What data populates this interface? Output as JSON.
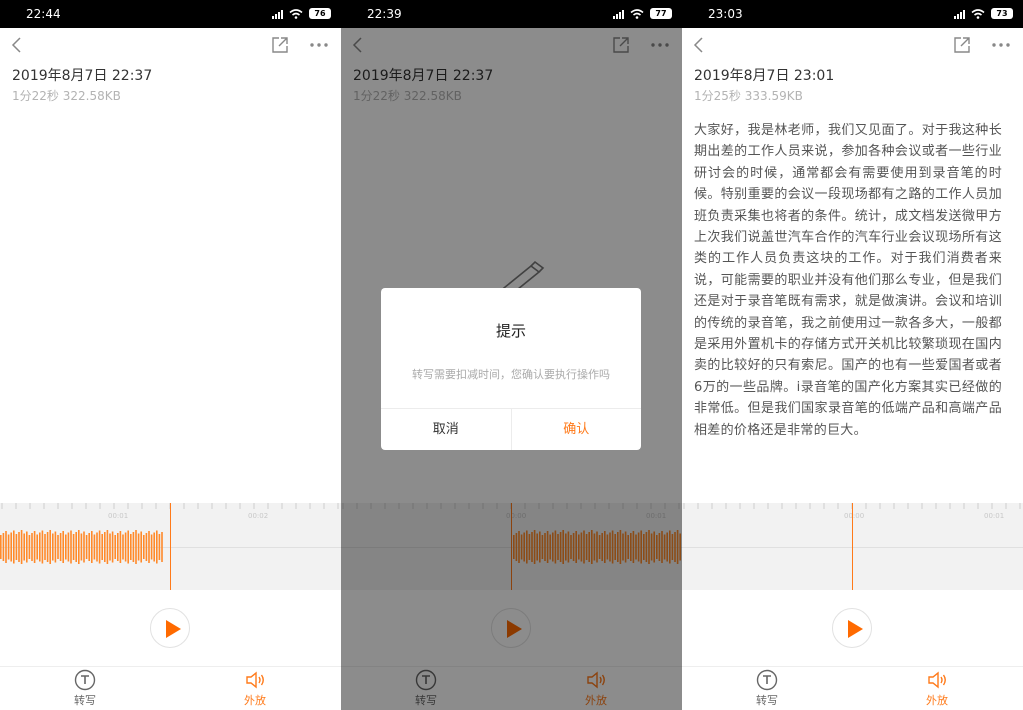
{
  "colors": {
    "accent": "#ff7a1a",
    "wave_bg": "#f2f2f2",
    "dim": "rgba(0,0,0,0.45)"
  },
  "screens": [
    {
      "status": {
        "time": "22:44",
        "battery": "76"
      },
      "recording": {
        "title": "2019年8月7日 22:37",
        "meta": "1分22秒 322.58KB"
      },
      "wave": {
        "tick_labels": [
          "00:01",
          "00:02"
        ],
        "playhead_fraction": 0.5
      }
    },
    {
      "status": {
        "time": "22:39",
        "battery": "77"
      },
      "recording": {
        "title": "2019年8月7日 22:37",
        "meta": "1分22秒 322.58KB"
      },
      "wave": {
        "tick_labels": [
          "00:00",
          "00:01"
        ],
        "playhead_fraction": 0.5
      },
      "dialog": {
        "title": "提示",
        "message": "转写需要扣减时间，您确认要执行操作吗",
        "cancel_label": "取消",
        "confirm_label": "确认"
      }
    },
    {
      "status": {
        "time": "23:03",
        "battery": "73"
      },
      "recording": {
        "title": "2019年8月7日 23:01",
        "meta": "1分25秒 333.59KB"
      },
      "transcript": "大家好，我是林老师，我们又见面了。对于我这种长期出差的工作人员来说，参加各种会议或者一些行业研讨会的时候，通常都会有需要使用到录音笔的时候。特别重要的会议一段现场都有之路的工作人员加班负责采集也将者的条件。统计，成文档发送微甲方上次我们说盖世汽车合作的汽车行业会议现场所有这类的工作人员负责这块的工作。对于我们消费者来说，可能需要的职业并没有他们那么专业，但是我们还是对于录音笔既有需求，就是做演讲。会议和培训的传统的录音笔，我之前使用过一款各多大，一般都是采用外置机卡的存储方式开关机比较繁琐现在国内卖的比较好的只有索尼。国产的也有一些爱国者或者6万的一些品牌。i录音笔的国产化方案其实已经做的非常低。但是我们国家录音笔的低端产品和高端产品相差的价格还是非常的巨大。",
      "wave": {
        "tick_labels": [
          "00:00",
          "00:01"
        ],
        "playhead_fraction": 0.5
      }
    }
  ],
  "bottom": {
    "transcribe_label": "转写",
    "speaker_label": "外放"
  },
  "icons": [
    "back-icon",
    "share-icon",
    "more-icon",
    "play-icon",
    "transcribe-icon",
    "speaker-icon",
    "signal-icon",
    "wifi-icon",
    "battery-icon",
    "pen-icon"
  ]
}
